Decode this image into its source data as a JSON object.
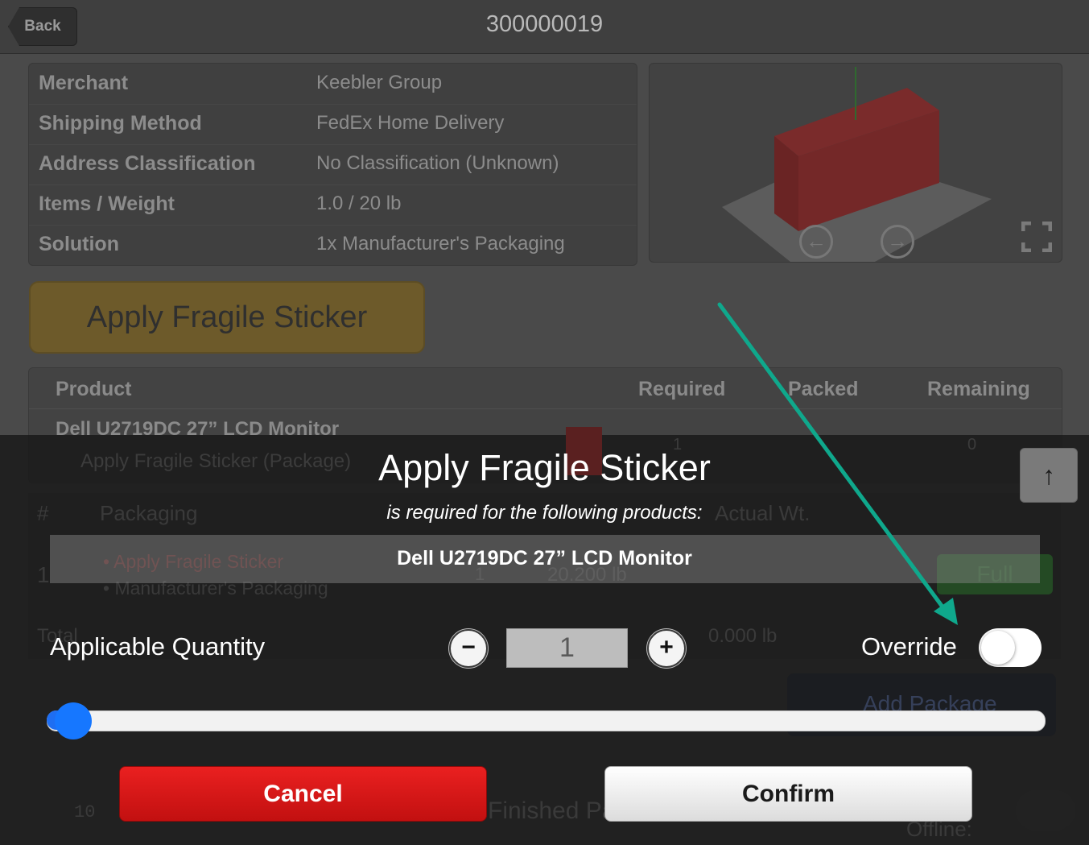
{
  "header": {
    "back_label": "Back",
    "order_id": "300000019"
  },
  "info": [
    {
      "label": "Merchant",
      "value": "Keebler Group"
    },
    {
      "label": "Shipping Method",
      "value": "FedEx Home Delivery"
    },
    {
      "label": "Address Classification",
      "value": "No Classification (Unknown)"
    },
    {
      "label": "Items / Weight",
      "value": "1.0 / 20 lb"
    },
    {
      "label": "Solution",
      "value": "1x Manufacturer's Packaging"
    }
  ],
  "fragile_button_label": "Apply Fragile Sticker",
  "product_table": {
    "headers": {
      "product": "Product",
      "required": "Required",
      "packed": "Packed",
      "remaining": "Remaining"
    },
    "row": {
      "name": "Dell U2719DC 27” LCD Monitor",
      "sub": "Apply Fragile Sticker (Package)",
      "required": "1",
      "remaining": "0"
    }
  },
  "packaging_table": {
    "hash": "#",
    "packaging": "Packaging",
    "actual_wt": "Actual Wt.",
    "row_num": "1",
    "item_fragile": "• Apply Fragile Sticker",
    "item_pack": "• Manufacturer's Packaging",
    "qty": "1",
    "weight": "20.200 lb",
    "full_label": "Full",
    "total_label": "Total",
    "total_actual": "0.000 lb"
  },
  "add_package_label": "Add Package",
  "bottom": {
    "count": "10",
    "finished_label": "Finished Pa",
    "offline_label": "Offline:"
  },
  "modal": {
    "title": "Apply Fragile Sticker",
    "subtitle": "is required for the following products:",
    "product": "Dell U2719DC 27” LCD Monitor",
    "qty_label": "Applicable Quantity",
    "qty_value": "1",
    "minus": "−",
    "plus": "+",
    "override_label": "Override",
    "override_on": false,
    "slider_fraction": 0.0,
    "cancel_label": "Cancel",
    "confirm_label": "Confirm"
  }
}
